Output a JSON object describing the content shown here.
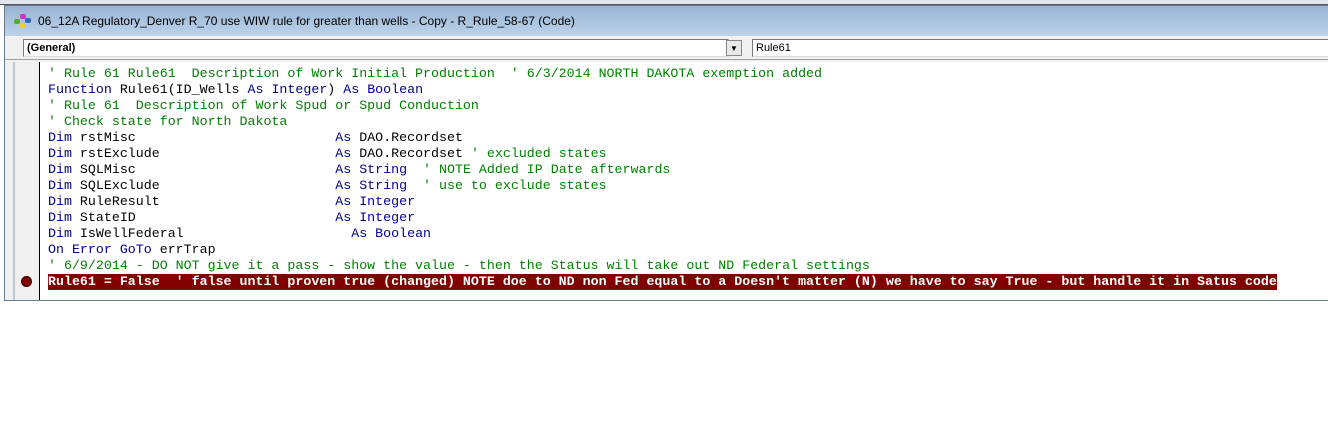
{
  "window": {
    "title": "06_12A Regulatory_Denver R_70 use WIW rule for greater than wells - Copy - R_Rule_58-67 (Code)",
    "icon": "vba-project-icon"
  },
  "object_combo": {
    "value": "(General)"
  },
  "procedure_combo": {
    "value": "Rule61"
  },
  "colors": {
    "keyword": "#00008b",
    "comment": "#008000",
    "breakpoint": "#800000"
  },
  "code_lines": [
    [
      {
        "t": "' Rule 61 Rule61  Description of Work Initial Production  ' 6/3/2014 NORTH DAKOTA exemption added",
        "c": "cm"
      }
    ],
    [
      {
        "t": "Function ",
        "c": "kw"
      },
      {
        "t": "Rule61(ID_Wells ",
        "c": "id"
      },
      {
        "t": "As Integer",
        "c": "kw"
      },
      {
        "t": ") ",
        "c": "id"
      },
      {
        "t": "As Boolean",
        "c": "kw"
      }
    ],
    [
      {
        "t": "' Rule 61  Description of Work Spud or Spud Conduction",
        "c": "cm"
      }
    ],
    [
      {
        "t": "' Check state for North Dakota",
        "c": "cm"
      }
    ],
    [
      {
        "t": "Dim ",
        "c": "kw"
      },
      {
        "t": "rstMisc                         ",
        "c": "id"
      },
      {
        "t": "As ",
        "c": "kw"
      },
      {
        "t": "DAO.Recordset",
        "c": "id"
      }
    ],
    [
      {
        "t": "Dim ",
        "c": "kw"
      },
      {
        "t": "rstExclude                      ",
        "c": "id"
      },
      {
        "t": "As ",
        "c": "kw"
      },
      {
        "t": "DAO.Recordset ",
        "c": "id"
      },
      {
        "t": "' excluded states",
        "c": "cm"
      }
    ],
    [
      {
        "t": "Dim ",
        "c": "kw"
      },
      {
        "t": "SQLMisc                         ",
        "c": "id"
      },
      {
        "t": "As String  ",
        "c": "kw"
      },
      {
        "t": "' NOTE Added IP Date afterwards",
        "c": "cm"
      }
    ],
    [
      {
        "t": "Dim ",
        "c": "kw"
      },
      {
        "t": "SQLExclude                      ",
        "c": "id"
      },
      {
        "t": "As String  ",
        "c": "kw"
      },
      {
        "t": "' use to exclude states",
        "c": "cm"
      }
    ],
    [
      {
        "t": "Dim ",
        "c": "kw"
      },
      {
        "t": "RuleResult                      ",
        "c": "id"
      },
      {
        "t": "As Integer",
        "c": "kw"
      }
    ],
    [
      {
        "t": "Dim ",
        "c": "kw"
      },
      {
        "t": "StateID                         ",
        "c": "id"
      },
      {
        "t": "As Integer",
        "c": "kw"
      }
    ],
    [
      {
        "t": "Dim ",
        "c": "kw"
      },
      {
        "t": "IsWellFederal                     ",
        "c": "id"
      },
      {
        "t": "As Boolean",
        "c": "kw"
      }
    ],
    [
      {
        "t": "On Error GoTo ",
        "c": "kw"
      },
      {
        "t": "errTrap",
        "c": "id"
      }
    ],
    [
      {
        "t": "' 6/9/2014 - DO NOT give it a pass - show the value - then the Status will take out ND Federal settings",
        "c": "cm"
      }
    ],
    [
      {
        "t": "Rule61 = False  ' false until proven true (changed) NOTE doe to ND non Fed equal to a Doesn't matter (N) we have to say True - but handle it in Satus code",
        "c": "bp"
      }
    ]
  ]
}
